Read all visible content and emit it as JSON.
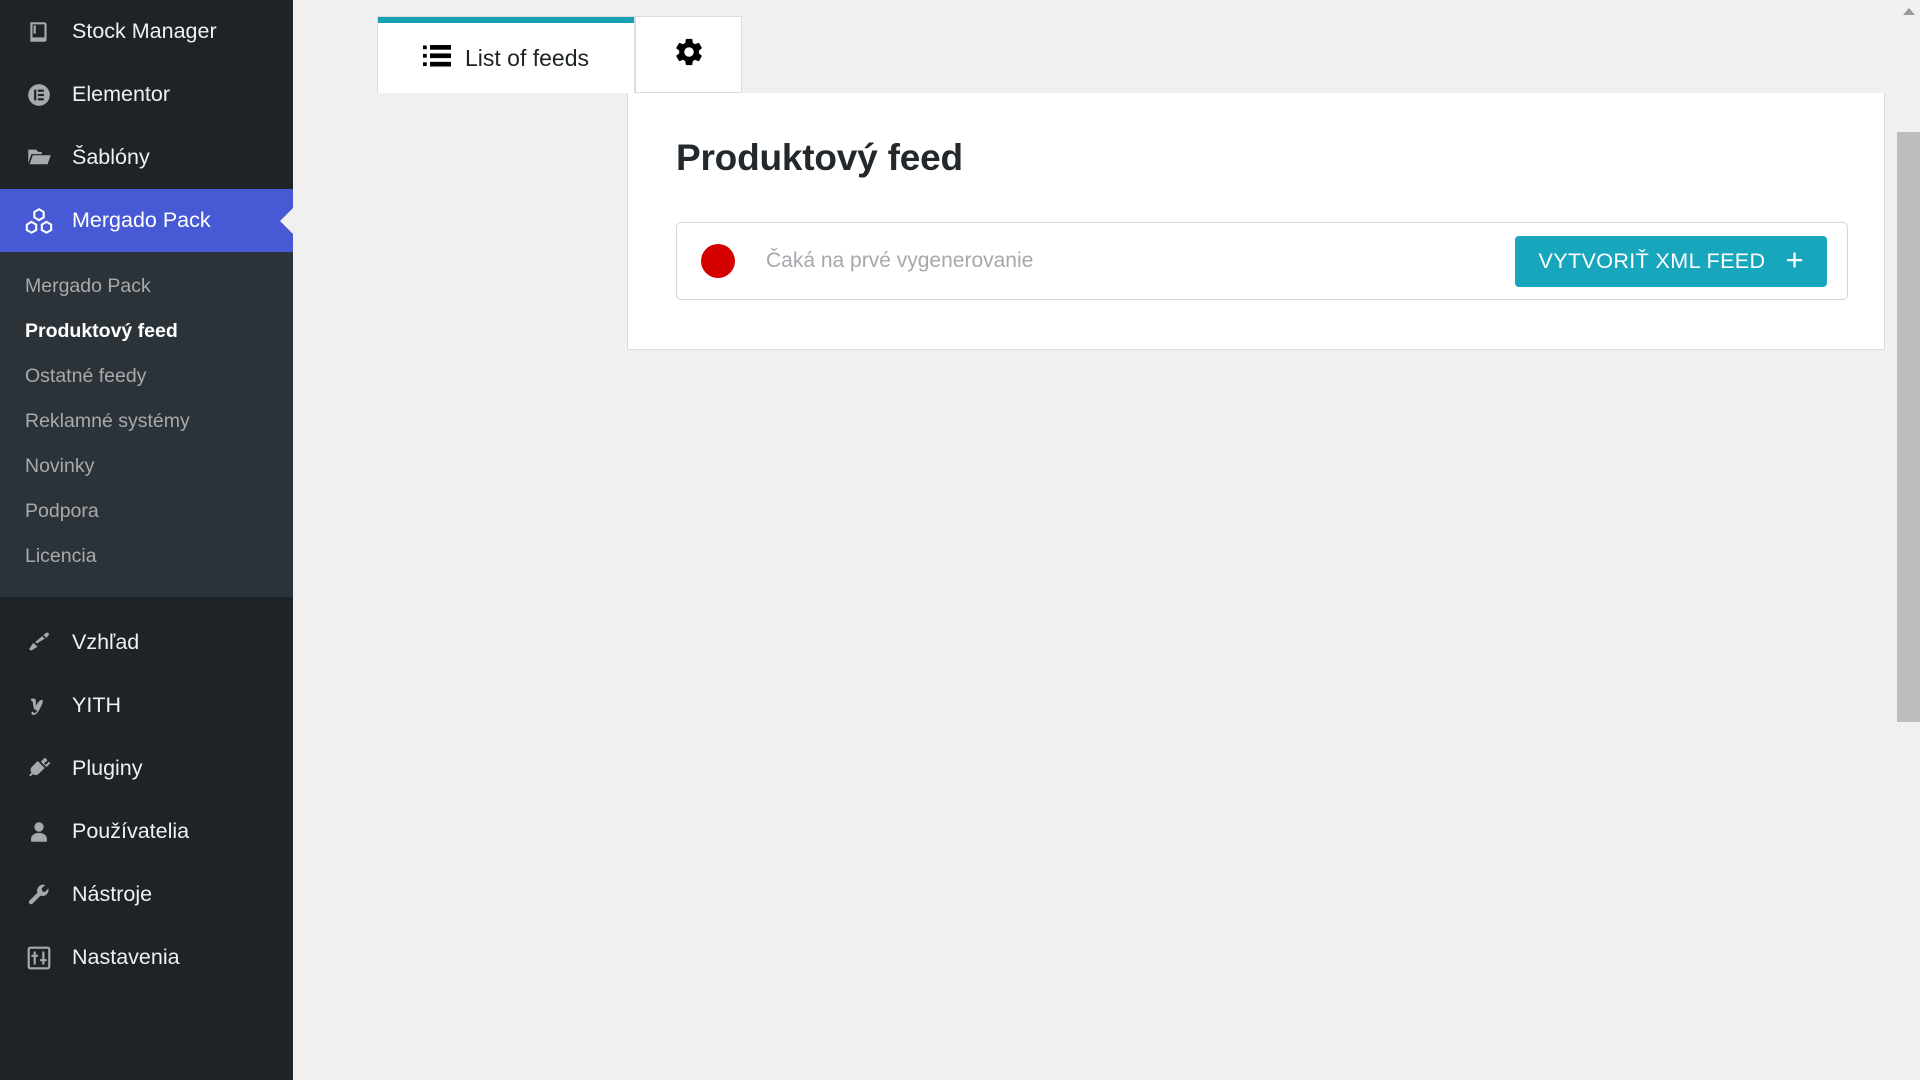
{
  "sidebar": {
    "top_items": [
      {
        "label": "Stock Manager",
        "icon": "book-icon"
      },
      {
        "label": "Elementor",
        "icon": "elementor-icon"
      },
      {
        "label": "Šablóny",
        "icon": "folder-icon"
      }
    ],
    "current_item": {
      "label": "Mergado Pack",
      "icon": "mergado-icon"
    },
    "submenu": [
      {
        "label": "Mergado Pack",
        "active": false
      },
      {
        "label": "Produktový feed",
        "active": true
      },
      {
        "label": "Ostatné feedy",
        "active": false
      },
      {
        "label": "Reklamné systémy",
        "active": false
      },
      {
        "label": "Novinky",
        "active": false
      },
      {
        "label": "Podpora",
        "active": false
      },
      {
        "label": "Licencia",
        "active": false
      }
    ],
    "bottom_items": [
      {
        "label": "Vzhľad",
        "icon": "paintbrush-icon"
      },
      {
        "label": "YITH",
        "icon": "yith-icon"
      },
      {
        "label": "Pluginy",
        "icon": "plug-icon"
      },
      {
        "label": "Používatelia",
        "icon": "user-icon"
      },
      {
        "label": "Nástroje",
        "icon": "wrench-icon"
      },
      {
        "label": "Nastavenia",
        "icon": "settings-sliders-icon"
      }
    ],
    "highlight_color": "#4759d4",
    "background_color": "#1d2327"
  },
  "tabs": [
    {
      "id": "list-of-feeds",
      "label": "List of feeds",
      "icon": "list-icon",
      "active": true
    },
    {
      "id": "settings",
      "label": "",
      "icon": "gear-icon",
      "active": false
    }
  ],
  "main": {
    "page_title": "Produktový feed",
    "feed_row": {
      "status_label": "Čaká na prvé vygenerovanie",
      "status_color": "#d40000",
      "create_button_label": "VYTVORIŤ XML FEED",
      "create_button_plus": "+",
      "accent_color": "#18a6bd"
    }
  }
}
